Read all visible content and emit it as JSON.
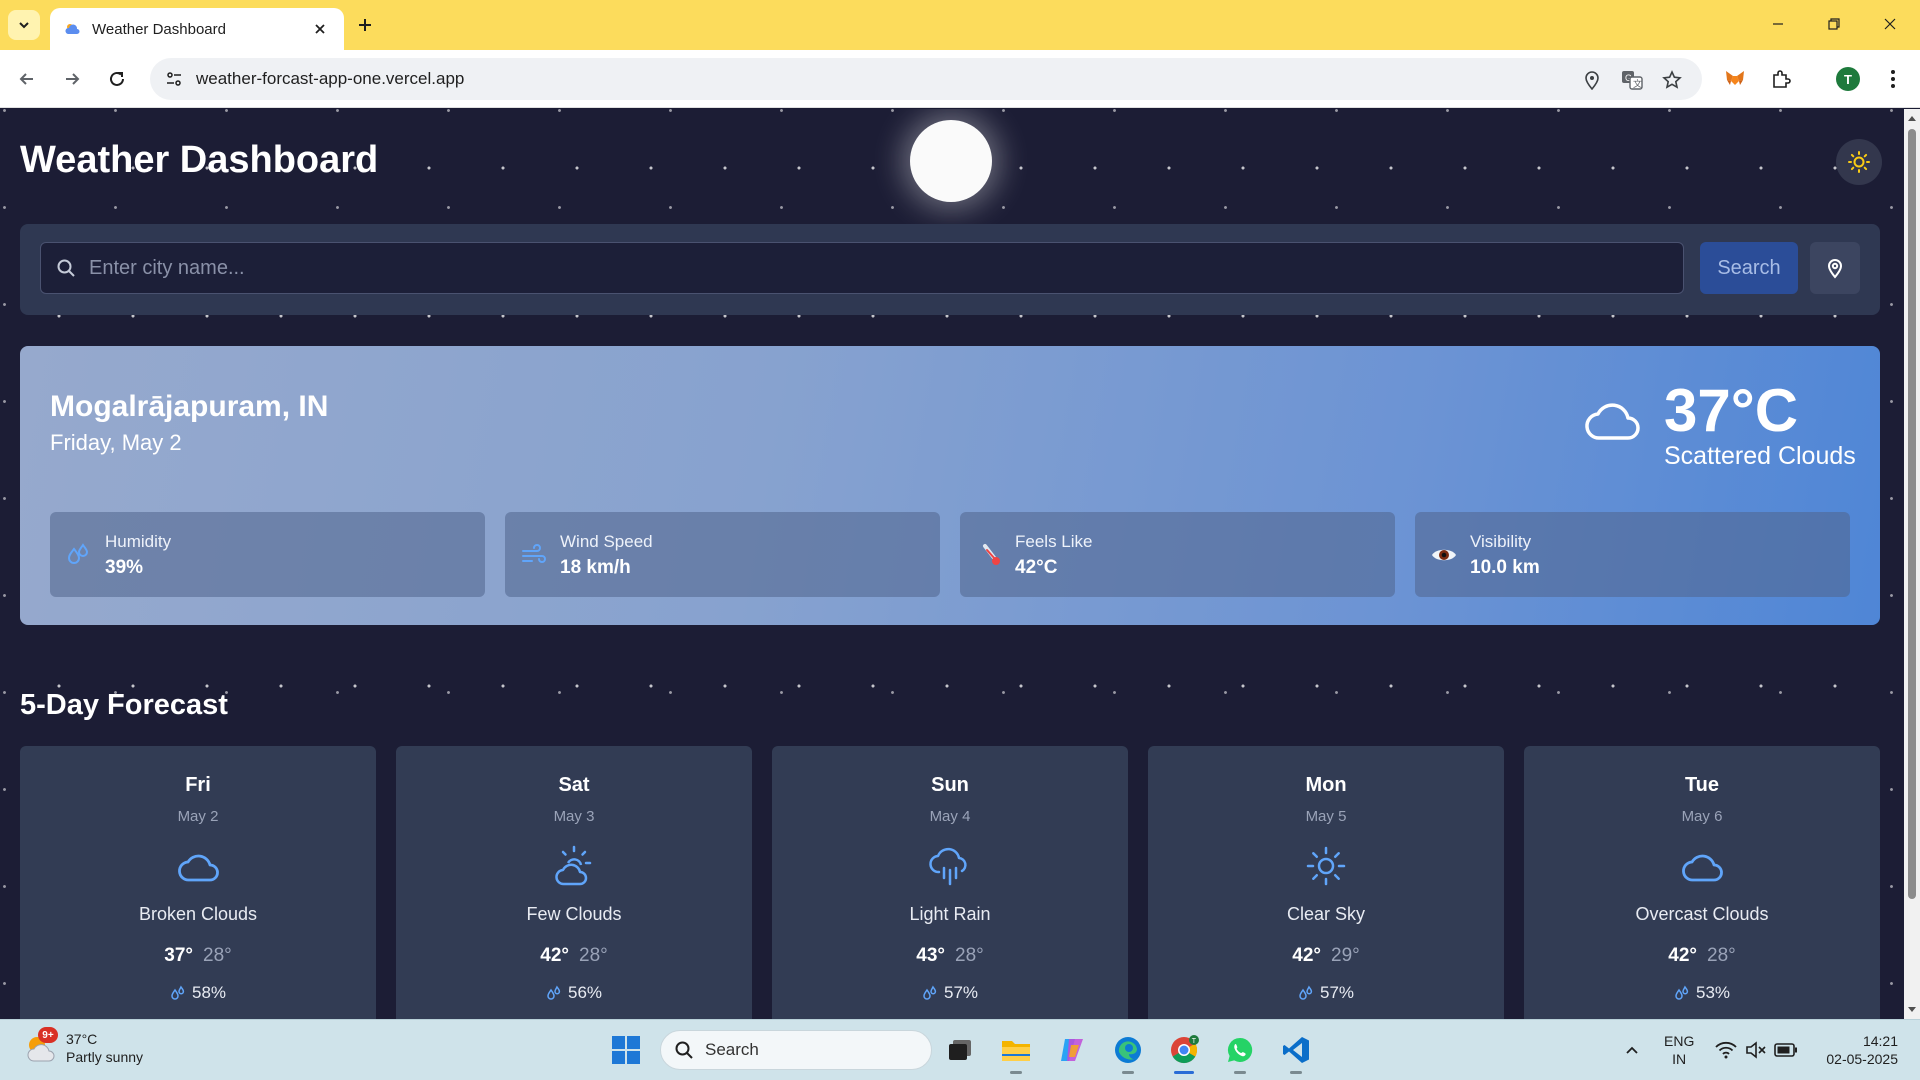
{
  "browser": {
    "tab_title": "Weather Dashboard",
    "url": "weather-forcast-app-one.vercel.app",
    "profile_initial": "T"
  },
  "page": {
    "title": "Weather Dashboard",
    "search": {
      "placeholder": "Enter city name...",
      "button_label": "Search"
    }
  },
  "current": {
    "city": "Mogalrājapuram, IN",
    "date": "Friday, May 2",
    "temperature": "37°C",
    "condition": "Scattered Clouds",
    "icon": "cloud-icon",
    "stats": [
      {
        "label": "Humidity",
        "value": "39%",
        "icon": "droplets-icon"
      },
      {
        "label": "Wind Speed",
        "value": "18 km/h",
        "icon": "wind-icon"
      },
      {
        "label": "Feels Like",
        "value": "42°C",
        "icon": "thermometer-icon"
      },
      {
        "label": "Visibility",
        "value": "10.0 km",
        "icon": "eye-icon"
      }
    ]
  },
  "forecast": {
    "heading": "5-Day Forecast",
    "days": [
      {
        "day": "Fri",
        "date": "May 2",
        "condition": "Broken Clouds",
        "high": "37°",
        "low": "28°",
        "humidity": "58%",
        "icon": "cloud-icon"
      },
      {
        "day": "Sat",
        "date": "May 3",
        "condition": "Few Clouds",
        "high": "42°",
        "low": "28°",
        "humidity": "56%",
        "icon": "cloud-sun-icon"
      },
      {
        "day": "Sun",
        "date": "May 4",
        "condition": "Light Rain",
        "high": "43°",
        "low": "28°",
        "humidity": "57%",
        "icon": "cloud-rain-icon"
      },
      {
        "day": "Mon",
        "date": "May 5",
        "condition": "Clear Sky",
        "high": "42°",
        "low": "29°",
        "humidity": "57%",
        "icon": "sun-icon"
      },
      {
        "day": "Tue",
        "date": "May 6",
        "condition": "Overcast Clouds",
        "high": "42°",
        "low": "28°",
        "humidity": "53%",
        "icon": "cloud-icon"
      }
    ]
  },
  "taskbar": {
    "weather_temp": "37°C",
    "weather_condition": "Partly sunny",
    "notification_badge": "9+",
    "search_label": "Search",
    "lang_top": "ENG",
    "lang_bottom": "IN",
    "time": "14:21",
    "date": "02-05-2025"
  },
  "colors": {
    "page_bg": "#1c1d35",
    "accent": "#60a5fa",
    "chrome_tabbar": "#fcdc5c"
  }
}
